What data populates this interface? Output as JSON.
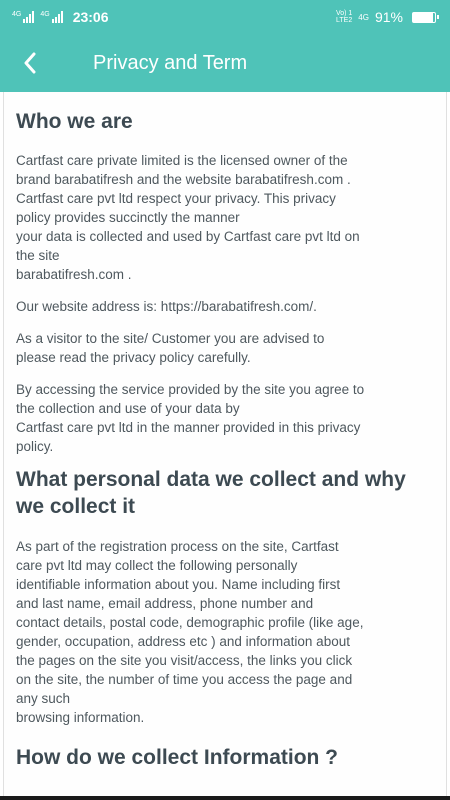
{
  "status_bar": {
    "sim1_label": "4G",
    "sim2_label": "4G",
    "time": "23:06",
    "volte_label_1": "Vo) 1",
    "volte_label_2": "LTE2",
    "network": "4G",
    "battery_text": "91%",
    "battery_level": 0.91,
    "icons": [
      "signal-icon",
      "signal-icon",
      "battery-icon"
    ]
  },
  "app_bar": {
    "title": "Privacy and Term",
    "back_icon": "chevron-left-icon",
    "color": "#4fc3b8"
  },
  "sections": {
    "who": {
      "heading": "Who we are",
      "p1_line1": "Cartfast care private limited is the licensed owner of the",
      "p1_line2": "brand barabatifresh and the website barabatifresh.com .",
      "p1_line3": "Cartfast care pvt ltd respect your privacy. This privacy",
      "p1_line4": "policy provides succinctly the manner",
      "p1_line5": "your data is collected and used by Cartfast care pvt ltd on",
      "p1_line6": "the site",
      "p1_line7": "barabatifresh.com .",
      "p2": "Our website address is: https://barabatifresh.com/.",
      "p3_line1": "As a visitor to the site/ Customer you are advised to",
      "p3_line2": "please read the privacy policy carefully.",
      "p4_line1": "By accessing the service provided by the site you agree to",
      "p4_line2": "the collection and use of your data by",
      "p4_line3": "Cartfast care pvt ltd in the manner provided in this privacy",
      "p4_line4": "policy."
    },
    "what": {
      "heading_line1": "What personal data we collect and why",
      "heading_line2": "we collect it",
      "p1_line1": "As part of the registration process on the site, Cartfast",
      "p1_line2": "care pvt ltd may collect the following personally",
      "p1_line3": "identifiable information about you. Name including first",
      "p1_line4": "and last name, email address, phone number and",
      "p1_line5": "contact details, postal code, demographic profile (like age,",
      "p1_line6": "gender, occupation, address etc ) and information about",
      "p1_line7": "the pages on the site you visit/access, the links you click",
      "p1_line8": "on the site, the number of time you access the page and",
      "p1_line9": "any such",
      "p1_line10": "browsing information."
    },
    "how": {
      "heading": "How do we collect Information ?"
    }
  }
}
